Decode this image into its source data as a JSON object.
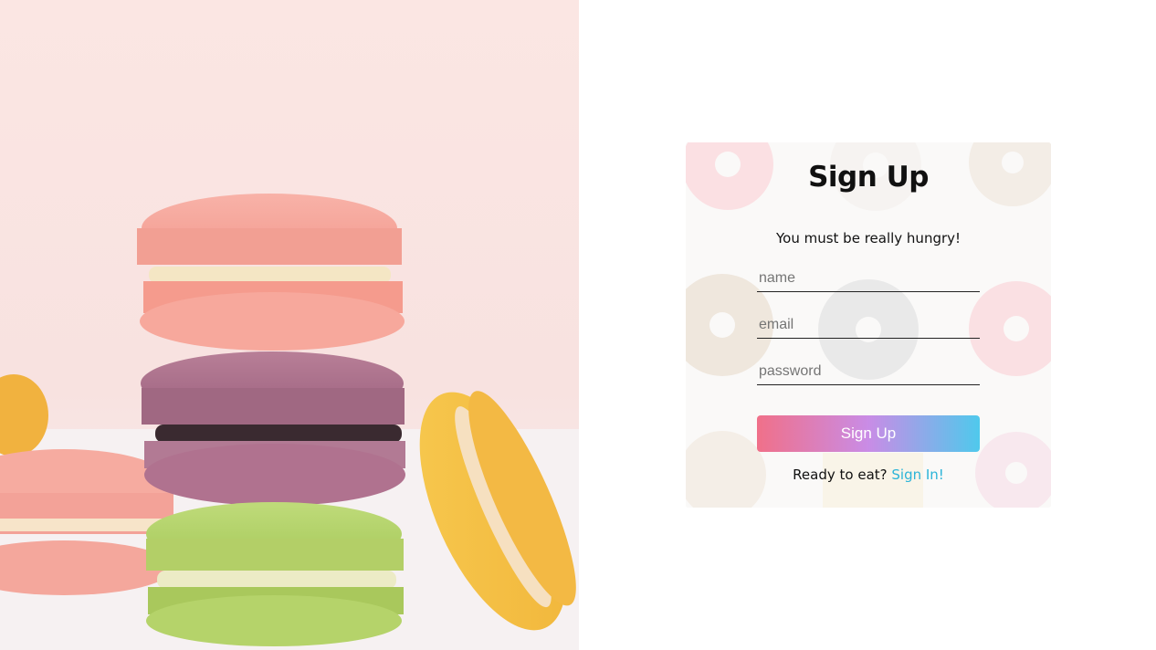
{
  "signup_card": {
    "title": "Sign Up",
    "subtitle": "You must be really hungry!",
    "fields": {
      "name_placeholder": "name",
      "email_placeholder": "email",
      "password_placeholder": "password"
    },
    "submit_label": "Sign Up",
    "footer_prompt": "Ready to eat?",
    "signin_link": "Sign In!"
  },
  "colors": {
    "button_gradient_start": "#f07089",
    "button_gradient_mid": "#c98ce6",
    "button_gradient_end": "#4fc9ec",
    "link": "#2bb4d8"
  },
  "images": {
    "hero": "macarons-photo",
    "card_background": "donuts-pattern"
  }
}
